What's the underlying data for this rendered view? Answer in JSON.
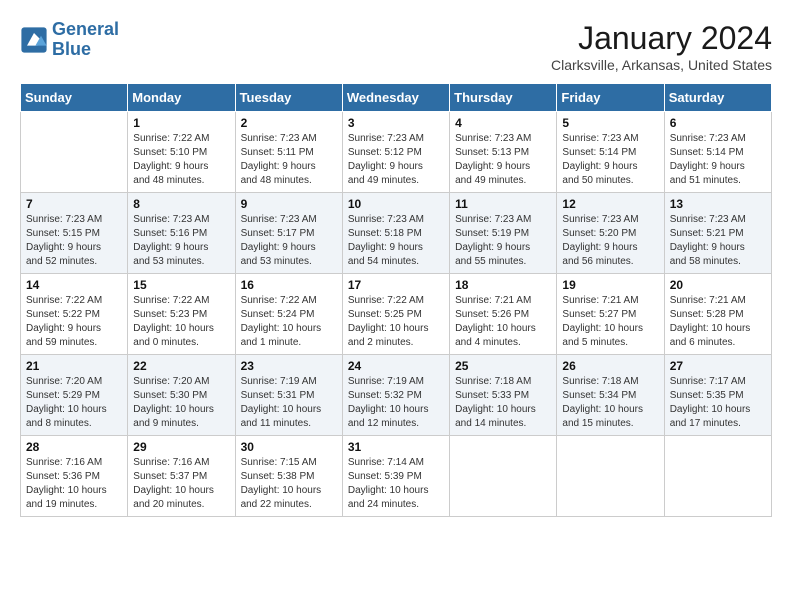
{
  "header": {
    "logo_line1": "General",
    "logo_line2": "Blue",
    "month": "January 2024",
    "location": "Clarksville, Arkansas, United States"
  },
  "weekdays": [
    "Sunday",
    "Monday",
    "Tuesday",
    "Wednesday",
    "Thursday",
    "Friday",
    "Saturday"
  ],
  "weeks": [
    [
      {
        "day": "",
        "info": ""
      },
      {
        "day": "1",
        "info": "Sunrise: 7:22 AM\nSunset: 5:10 PM\nDaylight: 9 hours\nand 48 minutes."
      },
      {
        "day": "2",
        "info": "Sunrise: 7:23 AM\nSunset: 5:11 PM\nDaylight: 9 hours\nand 48 minutes."
      },
      {
        "day": "3",
        "info": "Sunrise: 7:23 AM\nSunset: 5:12 PM\nDaylight: 9 hours\nand 49 minutes."
      },
      {
        "day": "4",
        "info": "Sunrise: 7:23 AM\nSunset: 5:13 PM\nDaylight: 9 hours\nand 49 minutes."
      },
      {
        "day": "5",
        "info": "Sunrise: 7:23 AM\nSunset: 5:14 PM\nDaylight: 9 hours\nand 50 minutes."
      },
      {
        "day": "6",
        "info": "Sunrise: 7:23 AM\nSunset: 5:14 PM\nDaylight: 9 hours\nand 51 minutes."
      }
    ],
    [
      {
        "day": "7",
        "info": "Sunrise: 7:23 AM\nSunset: 5:15 PM\nDaylight: 9 hours\nand 52 minutes."
      },
      {
        "day": "8",
        "info": "Sunrise: 7:23 AM\nSunset: 5:16 PM\nDaylight: 9 hours\nand 53 minutes."
      },
      {
        "day": "9",
        "info": "Sunrise: 7:23 AM\nSunset: 5:17 PM\nDaylight: 9 hours\nand 53 minutes."
      },
      {
        "day": "10",
        "info": "Sunrise: 7:23 AM\nSunset: 5:18 PM\nDaylight: 9 hours\nand 54 minutes."
      },
      {
        "day": "11",
        "info": "Sunrise: 7:23 AM\nSunset: 5:19 PM\nDaylight: 9 hours\nand 55 minutes."
      },
      {
        "day": "12",
        "info": "Sunrise: 7:23 AM\nSunset: 5:20 PM\nDaylight: 9 hours\nand 56 minutes."
      },
      {
        "day": "13",
        "info": "Sunrise: 7:23 AM\nSunset: 5:21 PM\nDaylight: 9 hours\nand 58 minutes."
      }
    ],
    [
      {
        "day": "14",
        "info": "Sunrise: 7:22 AM\nSunset: 5:22 PM\nDaylight: 9 hours\nand 59 minutes."
      },
      {
        "day": "15",
        "info": "Sunrise: 7:22 AM\nSunset: 5:23 PM\nDaylight: 10 hours\nand 0 minutes."
      },
      {
        "day": "16",
        "info": "Sunrise: 7:22 AM\nSunset: 5:24 PM\nDaylight: 10 hours\nand 1 minute."
      },
      {
        "day": "17",
        "info": "Sunrise: 7:22 AM\nSunset: 5:25 PM\nDaylight: 10 hours\nand 2 minutes."
      },
      {
        "day": "18",
        "info": "Sunrise: 7:21 AM\nSunset: 5:26 PM\nDaylight: 10 hours\nand 4 minutes."
      },
      {
        "day": "19",
        "info": "Sunrise: 7:21 AM\nSunset: 5:27 PM\nDaylight: 10 hours\nand 5 minutes."
      },
      {
        "day": "20",
        "info": "Sunrise: 7:21 AM\nSunset: 5:28 PM\nDaylight: 10 hours\nand 6 minutes."
      }
    ],
    [
      {
        "day": "21",
        "info": "Sunrise: 7:20 AM\nSunset: 5:29 PM\nDaylight: 10 hours\nand 8 minutes."
      },
      {
        "day": "22",
        "info": "Sunrise: 7:20 AM\nSunset: 5:30 PM\nDaylight: 10 hours\nand 9 minutes."
      },
      {
        "day": "23",
        "info": "Sunrise: 7:19 AM\nSunset: 5:31 PM\nDaylight: 10 hours\nand 11 minutes."
      },
      {
        "day": "24",
        "info": "Sunrise: 7:19 AM\nSunset: 5:32 PM\nDaylight: 10 hours\nand 12 minutes."
      },
      {
        "day": "25",
        "info": "Sunrise: 7:18 AM\nSunset: 5:33 PM\nDaylight: 10 hours\nand 14 minutes."
      },
      {
        "day": "26",
        "info": "Sunrise: 7:18 AM\nSunset: 5:34 PM\nDaylight: 10 hours\nand 15 minutes."
      },
      {
        "day": "27",
        "info": "Sunrise: 7:17 AM\nSunset: 5:35 PM\nDaylight: 10 hours\nand 17 minutes."
      }
    ],
    [
      {
        "day": "28",
        "info": "Sunrise: 7:16 AM\nSunset: 5:36 PM\nDaylight: 10 hours\nand 19 minutes."
      },
      {
        "day": "29",
        "info": "Sunrise: 7:16 AM\nSunset: 5:37 PM\nDaylight: 10 hours\nand 20 minutes."
      },
      {
        "day": "30",
        "info": "Sunrise: 7:15 AM\nSunset: 5:38 PM\nDaylight: 10 hours\nand 22 minutes."
      },
      {
        "day": "31",
        "info": "Sunrise: 7:14 AM\nSunset: 5:39 PM\nDaylight: 10 hours\nand 24 minutes."
      },
      {
        "day": "",
        "info": ""
      },
      {
        "day": "",
        "info": ""
      },
      {
        "day": "",
        "info": ""
      }
    ]
  ]
}
